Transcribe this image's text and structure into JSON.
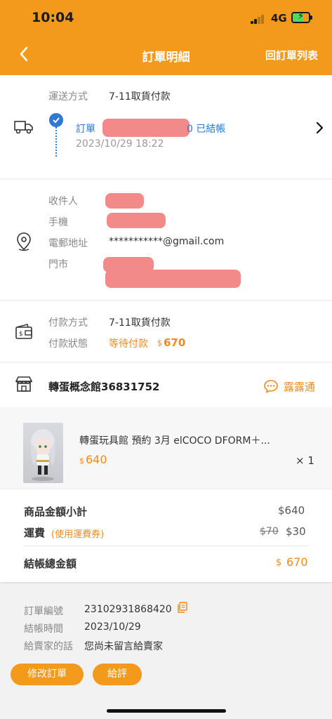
{
  "status_bar": {
    "time": "10:04",
    "network": "4G"
  },
  "nav": {
    "title": "訂單明細",
    "right_link": "回訂單列表"
  },
  "delivery": {
    "method_label": "運送方式",
    "method_value": "7-11取貨付款",
    "order_status_prefix": "訂單",
    "order_status_suffix": "0 已結帳",
    "order_status_time": "2023/10/29 18:22"
  },
  "recipient": {
    "name_label": "收件人",
    "phone_label": "手機",
    "email_label": "電郵地址",
    "email_value": "***********@gmail.com",
    "store_label": "門市"
  },
  "payment": {
    "method_label": "付款方式",
    "method_value": "7-11取貨付款",
    "status_label": "付款狀態",
    "status_value": "等待付款",
    "amount": "670",
    "currency": "$"
  },
  "shop": {
    "name": "轉蛋概念館36831752",
    "chat_label": "露露通"
  },
  "product": {
    "title": "轉蛋玩具館 預約 3月 elCOCO DFORM＋...",
    "price": "640",
    "currency": "$",
    "quantity": "× 1"
  },
  "summary": {
    "subtotal_label": "商品金額小計",
    "subtotal_value": "$640",
    "shipping_label": "運費",
    "shipping_note": "(使用運費券)",
    "shipping_original": "$70",
    "shipping_value": "$30",
    "total_label": "結帳總金額",
    "total_currency": "$",
    "total_value": "670"
  },
  "info": {
    "order_no_label": "訂單編號",
    "order_no_value": "23102931868420",
    "checkout_time_label": "結帳時間",
    "checkout_time_value": "2023/10/29",
    "message_label": "給賣家的話",
    "message_value": "您尚未留言給賣家"
  },
  "actions": {
    "edit_order": "修改訂單",
    "review": "給評"
  },
  "colors": {
    "brand_orange": "#f39a1c",
    "accent_orange": "#f08a1c",
    "link_blue": "#2f78d4",
    "redaction": "#f28a8a"
  }
}
